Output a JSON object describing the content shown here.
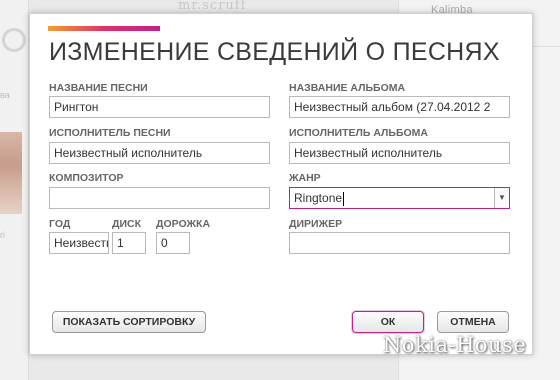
{
  "background": {
    "right_title": "Kalimba",
    "top_text": "mr.scruff",
    "left_text_1": "ва",
    "left_text_2": "ri"
  },
  "dialog": {
    "title": "ИЗМЕНЕНИЕ СВЕДЕНИЙ О ПЕСНЯХ",
    "accent_colors": [
      "#f0a030",
      "#e0306a",
      "#c0208a"
    ],
    "fields": {
      "song_title": {
        "label": "НАЗВАНИЕ ПЕСНИ",
        "value": "Рингтон"
      },
      "song_artist": {
        "label": "ИСПОЛНИТЕЛЬ ПЕСНИ",
        "value": "Неизвестный исполнитель"
      },
      "composer": {
        "label": "КОМПОЗИТОР",
        "value": ""
      },
      "year": {
        "label": "ГОД",
        "value": "Неизвестно"
      },
      "disc": {
        "label": "ДИСК",
        "value": "1"
      },
      "track": {
        "label": "ДОРОЖКА",
        "value": "0"
      },
      "album_title": {
        "label": "НАЗВАНИЕ АЛЬБОМА",
        "value": "Неизвестный альбом (27.04.2012 2"
      },
      "album_artist": {
        "label": "ИСПОЛНИТЕЛЬ АЛЬБОМА",
        "value": "Неизвестный исполнитель"
      },
      "genre": {
        "label": "ЖАНР",
        "value": "Ringtone"
      },
      "conductor": {
        "label": "ДИРИЖЕР",
        "value": ""
      }
    },
    "buttons": {
      "show_sort": "ПОКАЗАТЬ СОРТИРОВКУ",
      "ok": "ОК",
      "cancel": "ОТМЕНА"
    }
  },
  "watermark": "Nokia-House"
}
